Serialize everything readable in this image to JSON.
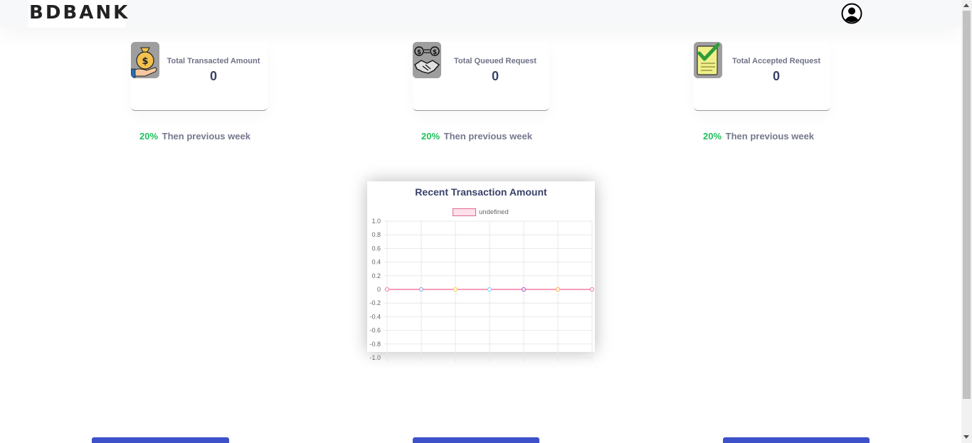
{
  "header": {
    "brand": "BDBANK",
    "avatar_icon": "user-circle-icon"
  },
  "stats": [
    {
      "icon": "money-bag-hand-icon",
      "label": "Total Transacted Amount",
      "value": "0",
      "change_pct": "20%",
      "change_text": "Then previous week"
    },
    {
      "icon": "handshake-exchange-icon",
      "label": "Total Queued Request",
      "value": "0",
      "change_pct": "20%",
      "change_text": "Then previous week"
    },
    {
      "icon": "checklist-icon",
      "label": "Total Accepted Request",
      "value": "0",
      "change_pct": "20%",
      "change_text": "Then previous week"
    }
  ],
  "colors": {
    "accent_green": "#1fbf5c",
    "button_blue": "#3f51c9",
    "series_line": "#f06292"
  },
  "chart_data": {
    "type": "line",
    "title": "Recent Transaction Amount",
    "legend": [
      "undefined"
    ],
    "legend_position": "top",
    "series": [
      {
        "name": "undefined",
        "values": [
          0,
          0,
          0,
          0,
          0,
          0,
          0
        ]
      }
    ],
    "point_colors": [
      "#f48fb1",
      "#9fa8da",
      "#ffd54f",
      "#81d4fa",
      "#ba68c8",
      "#ffb74d",
      "#f48fb1"
    ],
    "ylim": [
      -1.0,
      1.0
    ],
    "y_ticks": [
      "1.0",
      "0.8",
      "0.6",
      "0.4",
      "0.2",
      "0",
      "-0.2",
      "-0.4",
      "-0.6",
      "-0.8",
      "-1.0"
    ],
    "grid": true
  }
}
